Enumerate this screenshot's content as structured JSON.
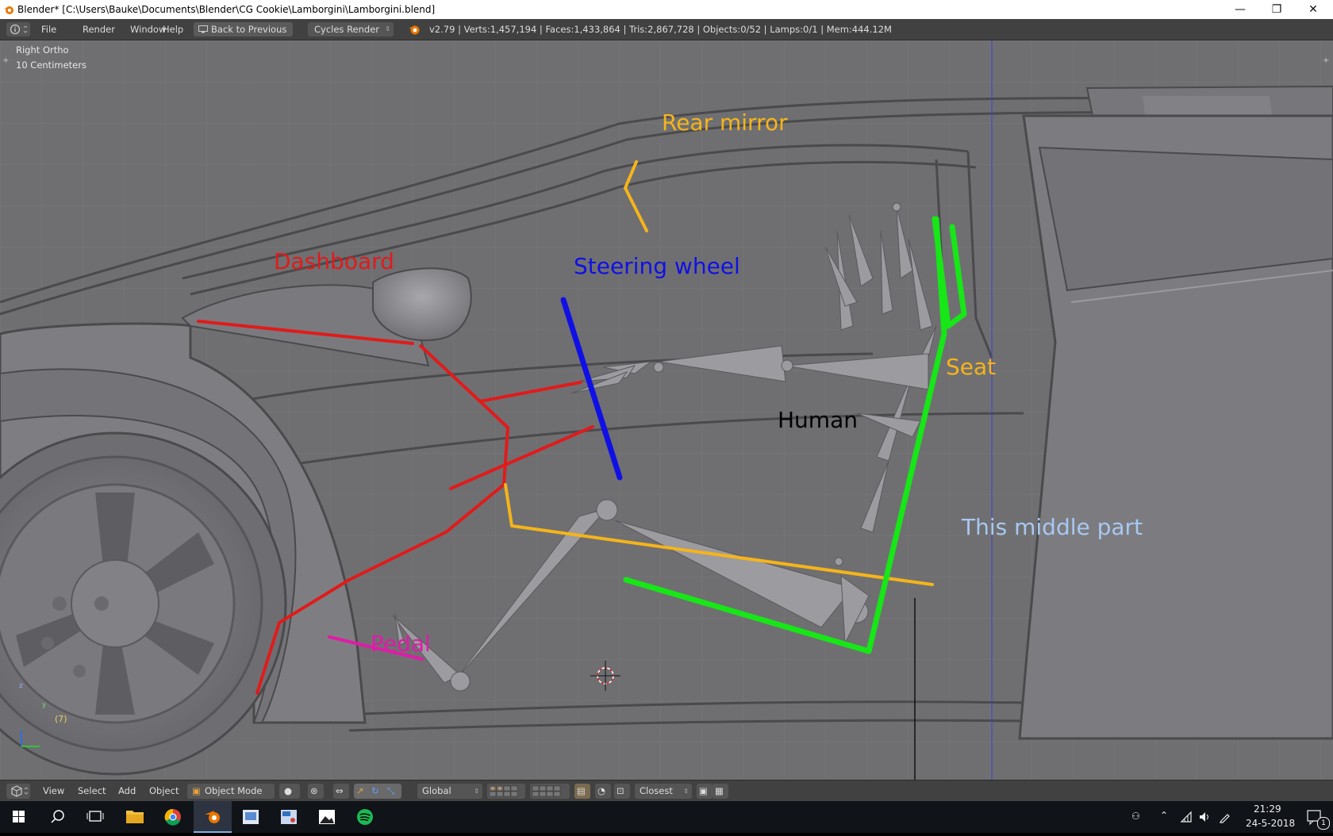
{
  "window": {
    "title": "Blender* [C:\\Users\\Bauke\\Documents\\Blender\\CG Cookie\\Lamborgini\\Lamborgini.blend]",
    "minimize_symbol": "—",
    "restore_symbol": "❐",
    "close_symbol": "✕"
  },
  "info_header": {
    "menus": [
      "File",
      "Render",
      "Window",
      "Help"
    ],
    "back_button": "Back to Previous",
    "render_engine": "Cycles Render",
    "stats": "v2.79 | Verts:1,457,194 | Faces:1,433,864 | Tris:2,867,728 | Objects:0/52 | Lamps:0/1 | Mem:444.12M"
  },
  "viewport": {
    "view_name": "Right Ortho",
    "scale": "10 Centimeters",
    "frame": "(7)",
    "axis_z": "z",
    "axis_y": "y",
    "colors": {
      "background": "#6f6f72",
      "body": "#7c7c80",
      "line": "#4a4a4c"
    }
  },
  "annotations": [
    {
      "text": "Rear mirror",
      "color": "#f5b41a"
    },
    {
      "text": "Dashboard",
      "color": "#e01b1b"
    },
    {
      "text": "Steering wheel",
      "color": "#1010e6"
    },
    {
      "text": "Seat",
      "color": "#f5b41a"
    },
    {
      "text": "Human",
      "color": "#000000"
    },
    {
      "text": "This middle part",
      "color": "#a8c8f0"
    },
    {
      "text": "Pedal",
      "color": "#e01ba8"
    }
  ],
  "bottom_bar": {
    "menus": [
      "View",
      "Select",
      "Add",
      "Object"
    ],
    "mode": "Object Mode",
    "orientation": "Global",
    "snap_target": "Closest"
  },
  "taskbar": {
    "apps": [
      "start-icon",
      "search-icon",
      "task-view-icon",
      "file-explorer-icon",
      "chrome-icon",
      "blender-icon",
      "image-viewer-icon",
      "paint-icon",
      "photos-icon",
      "spotify-icon"
    ],
    "time": "21:29",
    "date": "24-5-2018",
    "notifications": "1"
  }
}
